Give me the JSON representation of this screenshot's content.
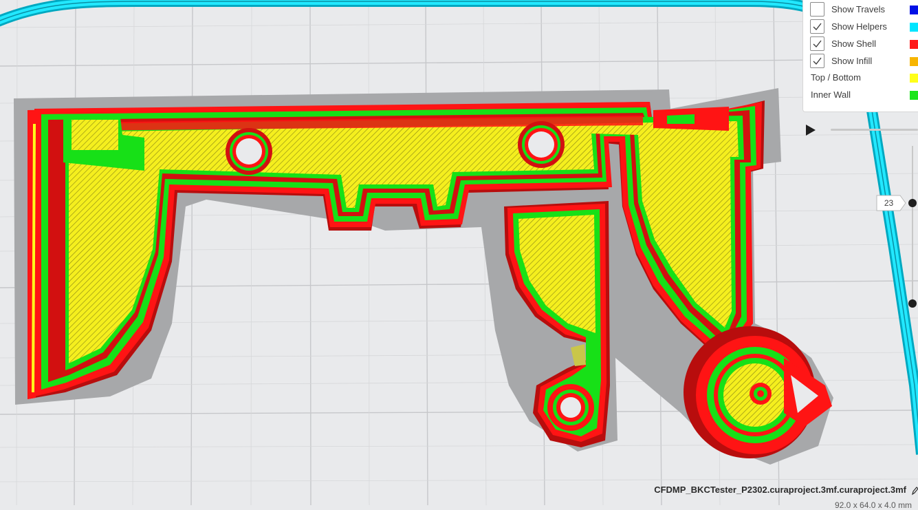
{
  "legend": {
    "items": [
      {
        "label": "Show Travels",
        "checkbox": true,
        "checked": false,
        "color": "#0010e6"
      },
      {
        "label": "Show Helpers",
        "checkbox": true,
        "checked": true,
        "color": "#00e5ff"
      },
      {
        "label": "Show Shell",
        "checkbox": true,
        "checked": true,
        "color": "#ff1a1a"
      },
      {
        "label": "Show Infill",
        "checkbox": true,
        "checked": true,
        "color": "#f7b500"
      },
      {
        "label": "Top / Bottom",
        "checkbox": false,
        "color": "#ffff1a"
      },
      {
        "label": "Inner Wall",
        "checkbox": false,
        "color": "#1ae51a"
      }
    ]
  },
  "simulation": {
    "play_icon": "play-icon",
    "layer_number": "23"
  },
  "file": {
    "name": "CFDMP_BKCTester_P2302.curaproject.3mf.curaproject.3mf",
    "dimensions": "92.0 x 64.0 x 4.0 mm"
  },
  "colors": {
    "shell": "#ff1a1a",
    "inner_wall": "#1ae51a",
    "top_bottom": "#ffff1a",
    "helpers": "#00e5ff",
    "travels": "#0010e6"
  }
}
